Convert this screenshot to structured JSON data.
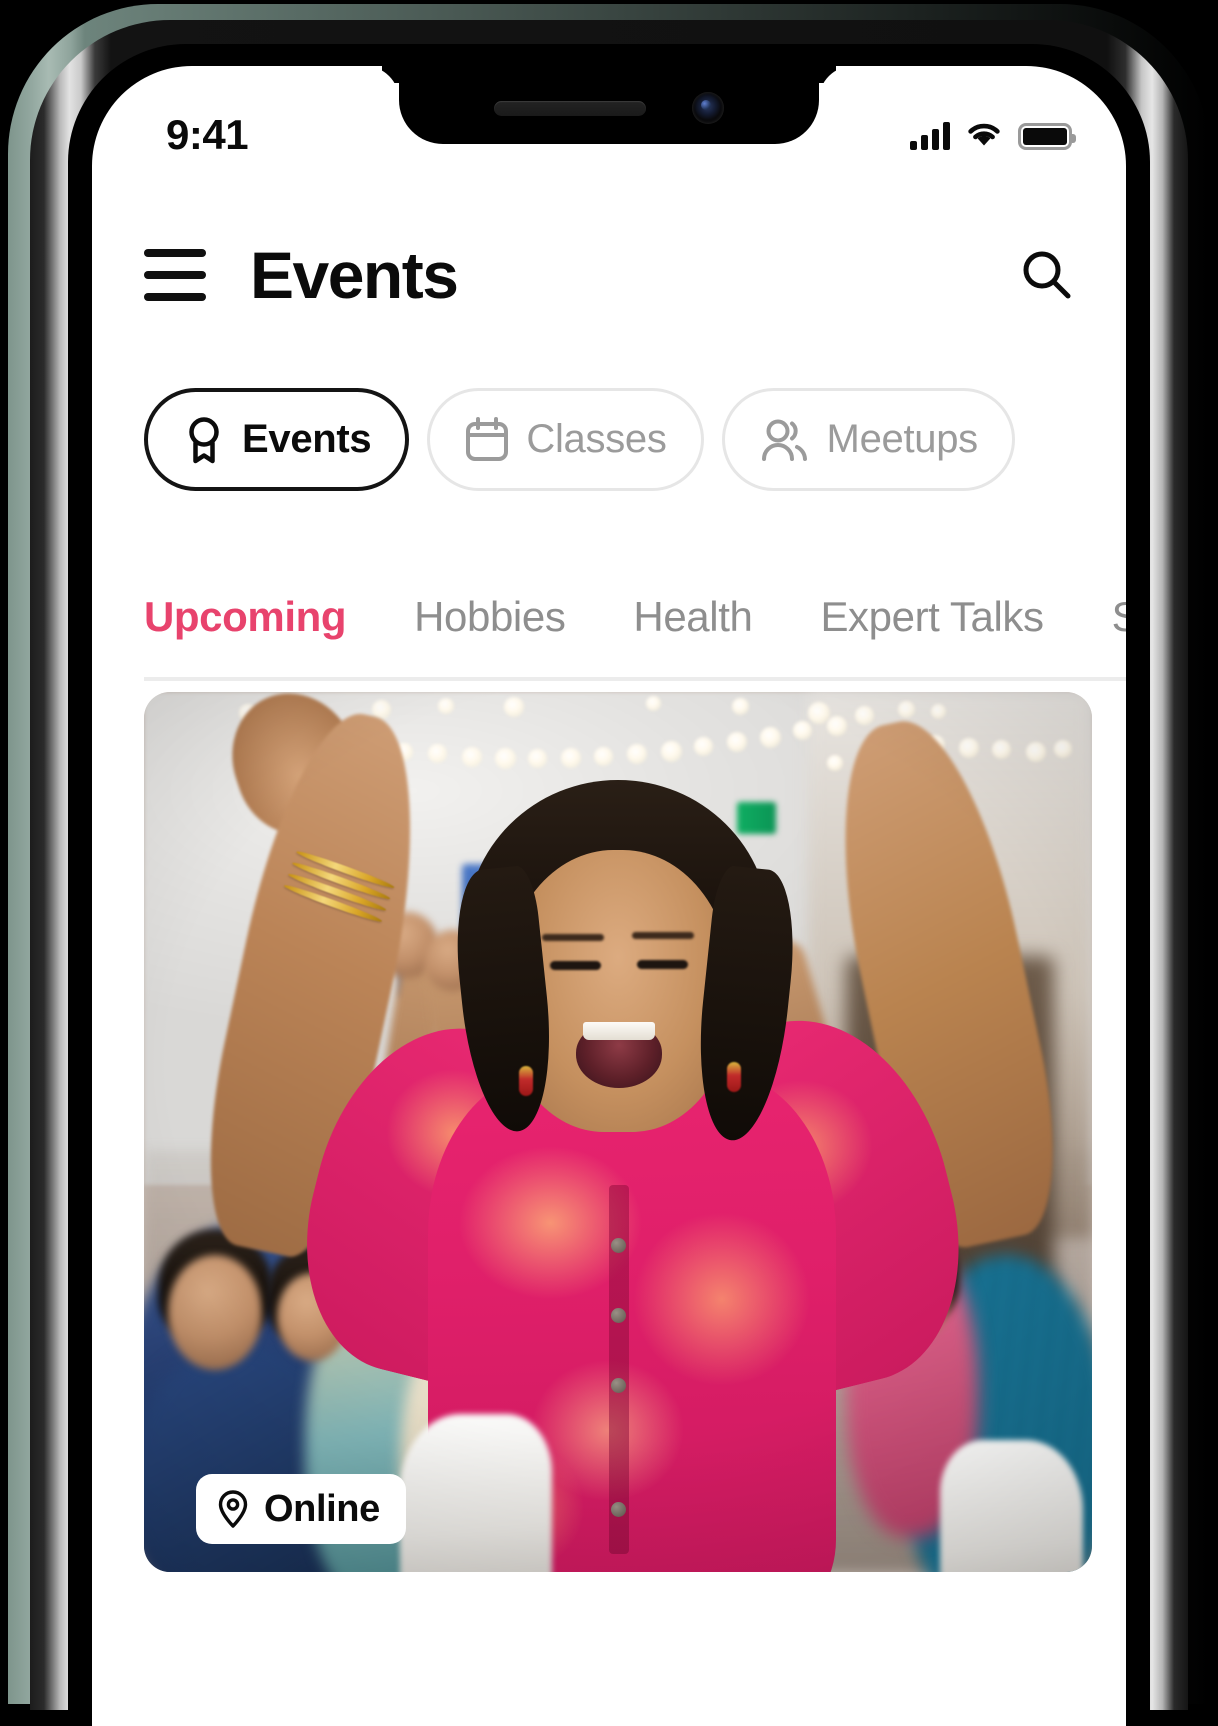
{
  "status_bar": {
    "time": "9:41",
    "signal_icon": "cellular-signal-icon",
    "wifi_icon": "wifi-icon",
    "battery_icon": "battery-icon"
  },
  "header": {
    "menu_icon": "hamburger-menu-icon",
    "title": "Events",
    "search_icon": "search-icon"
  },
  "segments": [
    {
      "label": "Events",
      "icon": "award-ribbon-icon",
      "active": true
    },
    {
      "label": "Classes",
      "icon": "calendar-icon",
      "active": false
    },
    {
      "label": "Meetups",
      "icon": "users-group-icon",
      "active": false
    }
  ],
  "tabs": [
    {
      "label": "Upcoming",
      "active": true
    },
    {
      "label": "Hobbies",
      "active": false
    },
    {
      "label": "Health",
      "active": false
    },
    {
      "label": "Expert Talks",
      "active": false
    },
    {
      "label": "Skills",
      "active": false
    }
  ],
  "event_card": {
    "badge": {
      "icon": "location-pin-icon",
      "label": "Online"
    },
    "photo_alt": "Smiling woman in pink and orange kurta raising both arms with a cheering crowd at an indoor event with string lights"
  },
  "colors": {
    "accent_pink": "#e8436d",
    "text_primary": "#0b0b0b",
    "text_muted": "#8e8e8e",
    "pill_border": "#e6e6e6",
    "pill_border_active": "#141414",
    "divider": "#ececec",
    "screen_bg": "#ffffff",
    "frame_green": "#8fa49c"
  }
}
